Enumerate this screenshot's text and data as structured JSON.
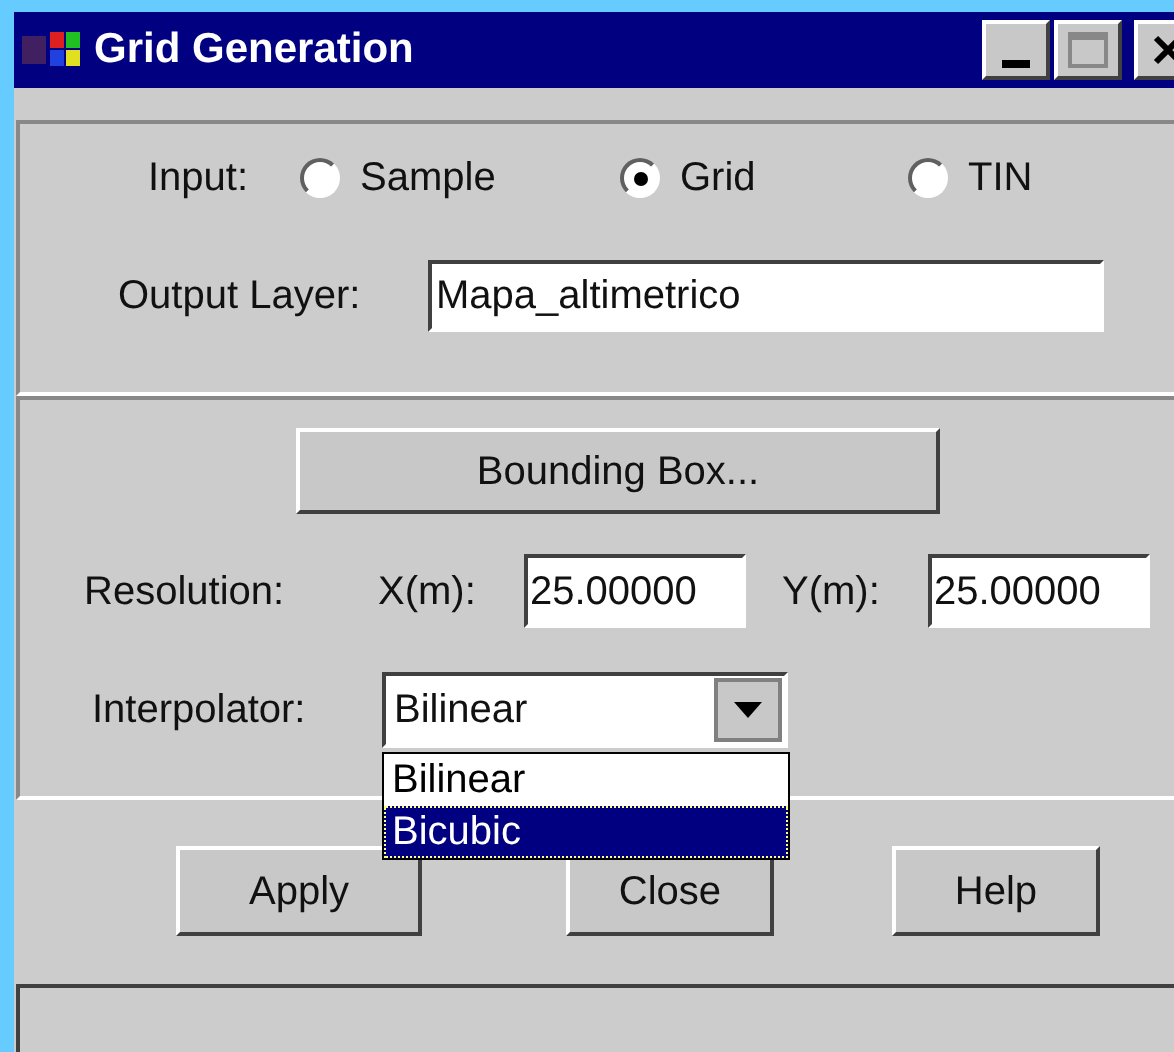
{
  "window": {
    "title": "Grid Generation"
  },
  "input": {
    "label": "Input:",
    "options": [
      {
        "label": "Sample",
        "selected": false
      },
      {
        "label": "Grid",
        "selected": true
      },
      {
        "label": "TIN",
        "selected": false
      }
    ]
  },
  "output_layer": {
    "label": "Output Layer:",
    "value": "Mapa_altimetrico"
  },
  "bounding_box_button": "Bounding Box...",
  "resolution": {
    "label": "Resolution:",
    "x_label": "X(m):",
    "x_value": "25.00000",
    "y_label": "Y(m):",
    "y_value": "25.00000"
  },
  "interpolator": {
    "label": "Interpolator:",
    "value": "Bilinear",
    "expanded": true,
    "options": [
      {
        "label": "Bilinear",
        "highlighted": false
      },
      {
        "label": "Bicubic",
        "highlighted": true
      }
    ]
  },
  "buttons": [
    "Apply",
    "Close",
    "Help"
  ]
}
